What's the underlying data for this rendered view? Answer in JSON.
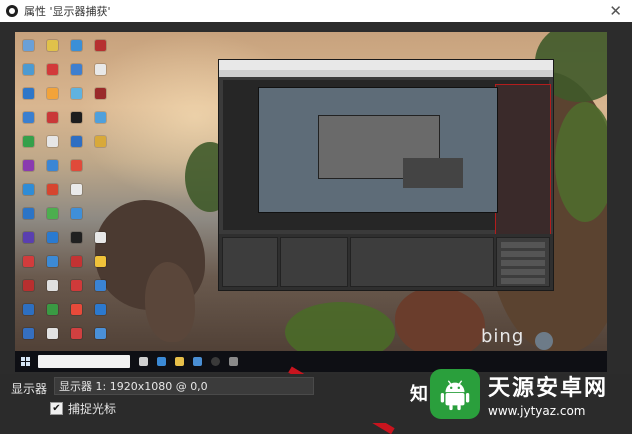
{
  "window": {
    "title": "属性 '显示器捕获'",
    "close_glyph": "✕"
  },
  "settings": {
    "display_label": "显示器",
    "display_value": "显示器 1: 1920x1080 @ 0,0",
    "capture_cursor_label": "捕捉光标",
    "capture_cursor_checked": true,
    "checkbox_glyph": "✔"
  },
  "overlay": {
    "zhi_char": "知",
    "bing_text": "bing"
  },
  "watermark": {
    "title": "天源安卓网",
    "url": "www.jytyaz.com"
  },
  "colors": {
    "accent_red": "#c8141e",
    "watermark_green": "#2a9f3c"
  }
}
